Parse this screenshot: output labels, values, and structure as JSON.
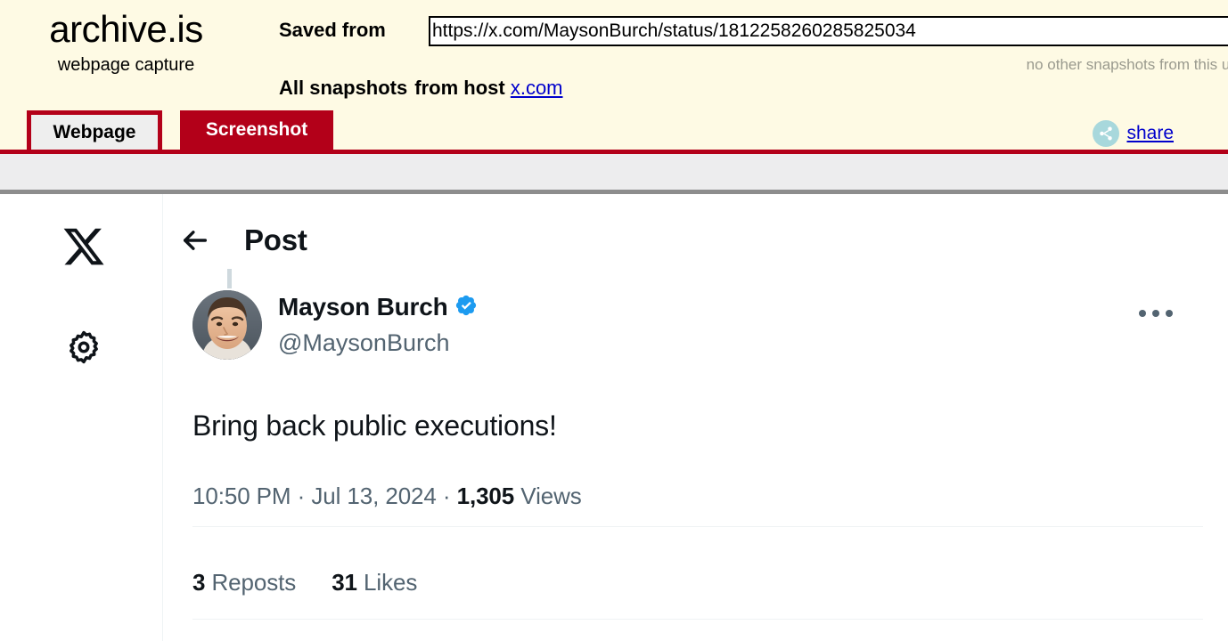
{
  "archive": {
    "logo": "archive.is",
    "tagline": "webpage capture",
    "saved_from_label": "Saved from",
    "url_value": "https://x.com/MaysonBurch/status/1812258260285825034",
    "no_other_snapshots": "no other snapshots from this ur",
    "all_snapshots_label": "All snapshots",
    "from_host_label": "from host",
    "host_link": "x.com",
    "tabs": [
      {
        "label": "Webpage",
        "active": true
      },
      {
        "label": "Screenshot",
        "active": false
      }
    ],
    "share_label": "share",
    "colors": {
      "cream": "#fefae4",
      "red": "#b30019",
      "share_circle": "#a8d8dc",
      "link": "#0000cc"
    }
  },
  "x_page": {
    "sidebar": {
      "logo_icon": "x-logo-icon",
      "settings_icon": "gear-icon"
    },
    "header": {
      "back_icon": "back-arrow-icon",
      "title": "Post"
    },
    "post": {
      "author_name": "Mayson Burch",
      "verified": true,
      "handle": "@MaysonBurch",
      "more_icon": "more-dots-icon",
      "text": "Bring back public executions!",
      "time": "10:50 PM",
      "separator": "·",
      "date": "Jul 13, 2024",
      "views_count": "1,305",
      "views_label": "Views",
      "engagement": [
        {
          "count": "3",
          "label": "Reposts"
        },
        {
          "count": "31",
          "label": "Likes"
        }
      ]
    },
    "colors": {
      "text": "#0f1419",
      "muted": "#536471",
      "verified_blue": "#1d9bf0",
      "divider": "#eff3f4"
    }
  }
}
